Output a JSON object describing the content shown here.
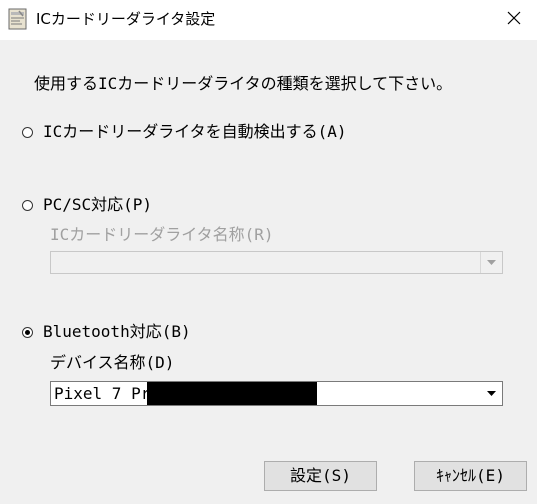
{
  "window": {
    "title": "ICカードリーダライタ設定",
    "close_glyph": "✕",
    "app_icon": "card-reader-app-icon"
  },
  "instruction": "使用するICカードリーダライタの種類を選択して下さい。",
  "options": {
    "auto": {
      "label": "ICカードリーダライタを自動検出する(A)",
      "selected": false
    },
    "pcsc": {
      "label": "PC/SC対応(P)",
      "selected": false,
      "sub_label": "ICカードリーダライタ名称(R)",
      "sub_value": ""
    },
    "bluetooth": {
      "label": "Bluetooth対応(B)",
      "selected": true,
      "sub_label": "デバイス名称(D)",
      "sub_value": "Pixel 7 Pro"
    }
  },
  "buttons": {
    "ok": "設定(S)",
    "cancel": "ｷｬﾝｾﾙ(E)"
  }
}
